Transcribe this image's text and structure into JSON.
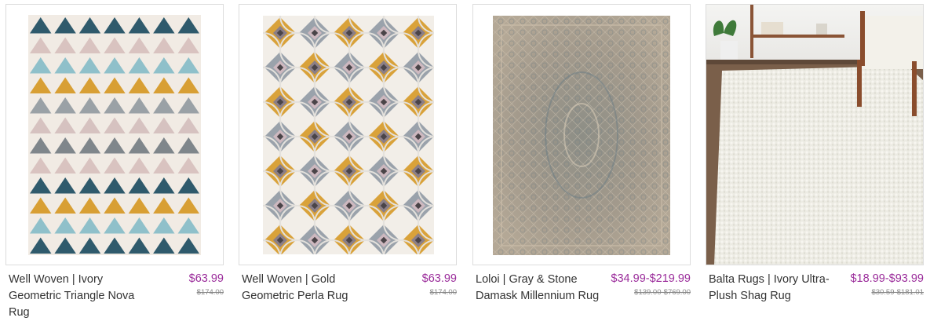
{
  "products": [
    {
      "title": "Well Woven | Ivory Geometric Triangle Nova Rug",
      "price": "$63.99",
      "original_price": "$174.00",
      "image": "triangle-rug-image"
    },
    {
      "title": "Well Woven | Gold Geometric Perla Rug",
      "price": "$63.99",
      "original_price": "$174.00",
      "image": "perla-rug-image"
    },
    {
      "title": "Loloi | Gray & Stone Damask Millennium Rug",
      "price": "$34.99-$219.99",
      "original_price": "$139.00-$769.00",
      "image": "damask-rug-image"
    },
    {
      "title": "Balta Rugs | Ivory Ultra-Plush Shag Rug",
      "price": "$18.99-$93.99",
      "original_price": "$30.59-$181.01",
      "image": "shag-rug-room-image"
    }
  ]
}
